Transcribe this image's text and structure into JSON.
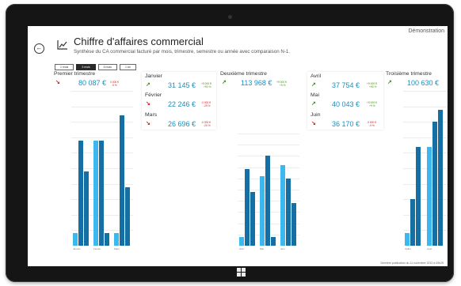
{
  "header": {
    "title": "Chiffre d'affaires commercial",
    "subtitle": "Synthèse du CA commercial facturé par mois, trimestre, semestre ou année avec comparaison N-1.",
    "user": "Démonstration",
    "back_icon": "back-arrow-icon",
    "logo_icon": "line-chart-icon"
  },
  "tabs": [
    {
      "label": "1 mois",
      "active": false
    },
    {
      "label": "3 mois",
      "active": true
    },
    {
      "label": "6 mois",
      "active": false
    },
    {
      "label": "1 an",
      "active": false
    }
  ],
  "colors": {
    "accent": "#1a8fbf",
    "light_bar": "#3cb8ef",
    "dark_bar": "#1470a4",
    "up": "#4a8a1a",
    "down": "#cc2222"
  },
  "quarters": [
    {
      "title": "Premier trimestre",
      "trend": "down",
      "value": "80 087 €",
      "var1": "0 000 €",
      "var2": "-9 %"
    },
    {
      "title": "Deuxième trimestre",
      "trend": "up",
      "value": "113 968 €",
      "var1": "+9 000 €",
      "var2": "+9 %"
    },
    {
      "title": "Troisième trimestre",
      "trend": "up",
      "value": "100 630 €",
      "var1": "",
      "var2": ""
    }
  ],
  "months": [
    {
      "name": "Janvier",
      "trend": "up",
      "value": "31 145 €",
      "var1": "+9 000 €",
      "var2": "+90 %"
    },
    {
      "name": "Février",
      "trend": "down",
      "value": "22 246 €",
      "var1": "-0 000 €",
      "var2": "-29 %"
    },
    {
      "name": "Mars",
      "trend": "down",
      "value": "26 696 €",
      "var1": "-0 000 €",
      "var2": "-20 %"
    },
    {
      "name": "Avril",
      "trend": "up",
      "value": "37 754 €",
      "var1": "+9 000 €",
      "var2": "+90 %"
    },
    {
      "name": "Mai",
      "trend": "up",
      "value": "40 043 €",
      "var1": "+9 000 €",
      "var2": "+9 %"
    },
    {
      "name": "Juin",
      "trend": "down",
      "value": "36 170 €",
      "var1": "-0 000 €",
      "var2": "-9 %"
    }
  ],
  "chart_data": [
    {
      "type": "bar",
      "categories": [
        "Janvier",
        "Février",
        "Mars"
      ],
      "series": [
        {
          "values": [
            4000,
            34000,
            4000
          ]
        },
        {
          "values": [
            34000,
            34000,
            42000
          ]
        },
        {
          "values": [
            24000,
            4000,
            19000
          ]
        }
      ],
      "ylim": [
        0,
        50000
      ]
    },
    {
      "type": "bar",
      "categories": [
        "Avril",
        "Mai",
        "Juin"
      ],
      "series": [
        {
          "values": [
            4000,
            31000,
            36000
          ]
        },
        {
          "values": [
            34000,
            40000,
            30000
          ]
        },
        {
          "values": [
            24000,
            4000,
            19000
          ]
        }
      ],
      "ylim": [
        0,
        50000
      ]
    },
    {
      "type": "bar",
      "categories": [
        "Juillet",
        "Août"
      ],
      "series": [
        {
          "values": [
            4000,
            32000
          ]
        },
        {
          "values": [
            15000,
            40000
          ]
        },
        {
          "values": [
            32000,
            44000
          ]
        }
      ],
      "ylim": [
        0,
        50000
      ]
    }
  ],
  "footer": "Dernière publication du 11 novembre 2013 à 09h25"
}
